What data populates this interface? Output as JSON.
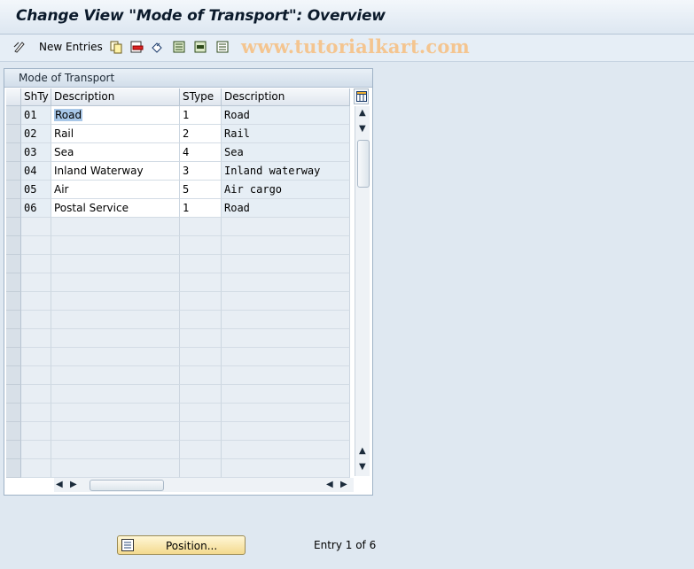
{
  "window": {
    "title": "Change View \"Mode of Transport\": Overview"
  },
  "toolbar": {
    "new_entries_label": "New Entries",
    "icons": [
      "edit-pencil-icon",
      "copy-icon",
      "delete-icon",
      "undo-icon",
      "select-all-icon",
      "select-block-icon",
      "deselect-all-icon"
    ],
    "watermark": "www.tutorialkart.com"
  },
  "table": {
    "title": "Mode of Transport",
    "columns": [
      "ShTy",
      "Description",
      "SType",
      "Description"
    ],
    "rows": [
      {
        "shty": "01",
        "description": "Road",
        "stype": "1",
        "stype_description": "Road"
      },
      {
        "shty": "02",
        "description": "Rail",
        "stype": "2",
        "stype_description": "Rail"
      },
      {
        "shty": "03",
        "description": "Sea",
        "stype": "4",
        "stype_description": "Sea"
      },
      {
        "shty": "04",
        "description": "Inland Waterway",
        "stype": "3",
        "stype_description": "Inland waterway"
      },
      {
        "shty": "05",
        "description": "Air",
        "stype": "5",
        "stype_description": "Air cargo"
      },
      {
        "shty": "06",
        "description": "Postal Service",
        "stype": "1",
        "stype_description": "Road"
      }
    ]
  },
  "footer": {
    "position_button_label": "Position...",
    "entry_status": "Entry 1 of 6"
  },
  "colors": {
    "accent": "#0b1a2b",
    "watermark": "#f4c590",
    "button": "#f3d98e"
  }
}
